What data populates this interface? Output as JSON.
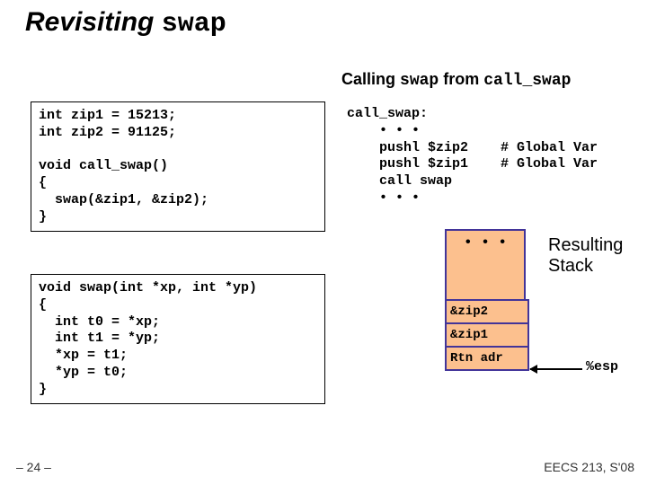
{
  "title_prefix": "Revisiting ",
  "title_mono": "swap",
  "subtitle_prefix": "Calling ",
  "subtitle_mono1": "swap",
  "subtitle_mid": " from ",
  "subtitle_mono2": "call_swap",
  "code1": "int zip1 = 15213;\nint zip2 = 91125;\n\nvoid call_swap()\n{\n  swap(&zip1, &zip2);\n}",
  "code2": "void swap(int *xp, int *yp)\n{\n  int t0 = *xp;\n  int t1 = *yp;\n  *xp = t1;\n  *yp = t0;\n}",
  "asm": "call_swap:\n    • • •\n    pushl $zip2    # Global Var\n    pushl $zip1    # Global Var\n    call swap\n    • • •",
  "stack_label_l1": "Resulting",
  "stack_label_l2": "Stack",
  "stack_dots": "•\n•\n•",
  "stack_cell1": "&zip2",
  "stack_cell2": "&zip1",
  "stack_cell3": "Rtn adr",
  "esp": "%esp",
  "footer_left": "– 24 –",
  "footer_right": "EECS 213, S'08"
}
